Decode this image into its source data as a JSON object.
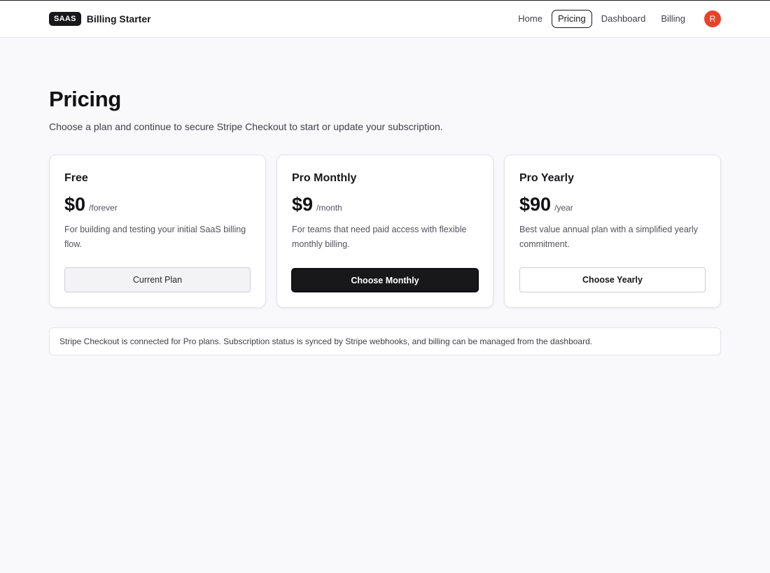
{
  "header": {
    "brand_badge": "SAAS",
    "brand_name": "Billing Starter",
    "nav": [
      {
        "label": "Home",
        "active": false
      },
      {
        "label": "Pricing",
        "active": true
      },
      {
        "label": "Dashboard",
        "active": false
      },
      {
        "label": "Billing",
        "active": false
      }
    ],
    "avatar_initial": "R",
    "avatar_color": "#e8432a"
  },
  "page": {
    "title": "Pricing",
    "subtitle": "Choose a plan and continue to secure Stripe Checkout to start or update your subscription."
  },
  "plans": [
    {
      "name": "Free",
      "price": "$0",
      "period": "/forever",
      "description": "For building and testing your initial SaaS billing flow.",
      "button_label": "Current Plan"
    },
    {
      "name": "Pro Monthly",
      "price": "$9",
      "period": "/month",
      "description": "For teams that need paid access with flexible monthly billing.",
      "button_label": "Choose Monthly"
    },
    {
      "name": "Pro Yearly",
      "price": "$90",
      "period": "/year",
      "description": "Best value annual plan with a simplified yearly commitment.",
      "button_label": "Choose Yearly"
    }
  ],
  "info_banner": {
    "text": "Stripe Checkout is connected for Pro plans. Subscription status is synced by Stripe webhooks, and billing can be managed from the dashboard."
  },
  "colors": {
    "primary": "#18181b",
    "background": "#f9f8fb",
    "avatar": "#e8432a"
  }
}
